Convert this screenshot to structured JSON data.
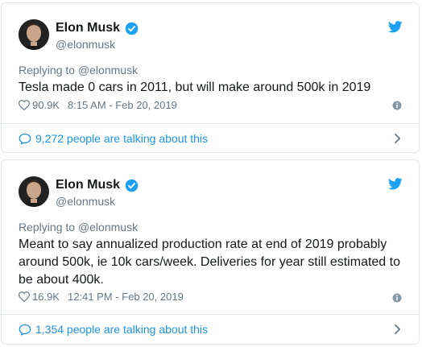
{
  "colors": {
    "brand_blue": "#1da1f2",
    "link_blue": "#1b95e0",
    "text_primary": "#14171a",
    "text_secondary": "#657786",
    "border": "#e1e8ed"
  },
  "icons": {
    "verified": "verified-badge-icon",
    "bird": "twitter-bird-icon",
    "heart": "heart-icon",
    "info": "info-icon",
    "bubble": "speech-bubble-icon",
    "chevron": "chevron-right-icon"
  },
  "tweets": [
    {
      "author_name": "Elon Musk",
      "author_handle": "@elonmusk",
      "reply_prefix": "Replying to ",
      "reply_mention": "@elonmusk",
      "text": "Tesla made 0 cars in 2011, but will make around 500k in 2019",
      "likes": "90.9K",
      "timestamp": "8:15 AM - Feb 20, 2019",
      "talking": "9,272 people are talking about this"
    },
    {
      "author_name": "Elon Musk",
      "author_handle": "@elonmusk",
      "reply_prefix": "Replying to ",
      "reply_mention": "@elonmusk",
      "text": "Meant to say annualized production rate at end of 2019 probably around 500k, ie 10k cars/week. Deliveries for year still estimated to be about 400k.",
      "likes": "16.9K",
      "timestamp": "12:41 PM - Feb 20, 2019",
      "talking": "1,354 people are talking about this"
    }
  ]
}
